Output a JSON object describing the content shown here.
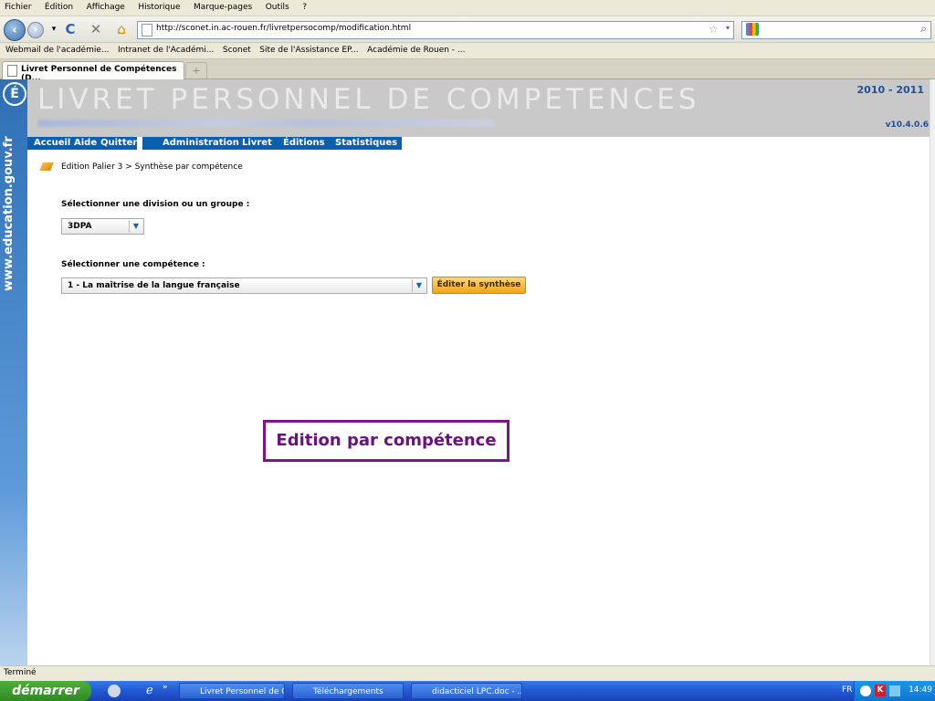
{
  "browser": {
    "menu": [
      "Fichier",
      "Édition",
      "Affichage",
      "Historique",
      "Marque-pages",
      "Outils",
      "?"
    ],
    "url": "http://sconet.in.ac-rouen.fr/livretpersocomp/modification.html",
    "bookmarks": [
      "Webmail de l'académie...",
      "Intranet de l'Académi...",
      "Sconet",
      "Site de l'Assistance EP...",
      "Académie de Rouen - ..."
    ],
    "tab_title": "Livret Personnel de Compétences (D...",
    "new_tab": "+",
    "status": "Terminé"
  },
  "app": {
    "side_label": "www.education.gouv.fr",
    "title": "LIVRET PERSONNEL DE COMPETENCES",
    "year": "2010 - 2011",
    "version": "v10.4.0.6",
    "nav_left": [
      "Accueil",
      "Aide",
      "Quitter"
    ],
    "nav_right": [
      "Administration",
      "Livret",
      "Éditions",
      "Statistiques"
    ],
    "breadcrumb": "Edition Palier 3 > Synthèse par compétence",
    "division_label": "Sélectionner une division ou un groupe :",
    "division_value": "3DPA",
    "competence_label": "Sélectionner une compétence :",
    "competence_value": "1 - La maîtrise de la langue française",
    "edit_button": "Éditer la synthèse"
  },
  "annotation": "Edition par compétence",
  "taskbar": {
    "start": "démarrer",
    "items": [
      "Livret Personnel de C...",
      "Téléchargements",
      "didacticiel LPC.doc - ..."
    ],
    "lang": "FR",
    "clock": "14:49"
  }
}
